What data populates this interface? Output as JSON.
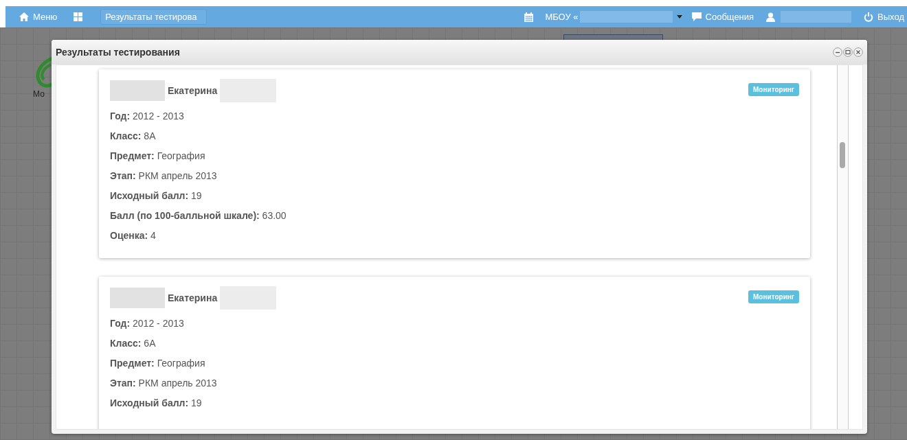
{
  "top_bar": {
    "menu_label": "Меню",
    "open_tab": "Результаты тестирова",
    "school_prefix": "МБОУ «",
    "messages_label": "Сообщения",
    "logout_label": "Выход"
  },
  "desktop": {
    "icon_label": "Мо"
  },
  "dialog": {
    "title": "Результаты тестирования",
    "cards": [
      {
        "name": "Екатерина",
        "badge": "Мониторинг",
        "fields": [
          {
            "label": "Год:",
            "value": "2012 - 2013"
          },
          {
            "label": "Класс:",
            "value": "8А"
          },
          {
            "label": "Предмет:",
            "value": "География"
          },
          {
            "label": "Этап:",
            "value": "РКМ апрель 2013"
          },
          {
            "label": "Исходный балл:",
            "value": "19"
          },
          {
            "label": "Балл (по 100-балльной шкале):",
            "value": "63.00"
          },
          {
            "label": "Оценка:",
            "value": "4"
          }
        ]
      },
      {
        "name": "Екатерина",
        "badge": "Мониторинг",
        "fields": [
          {
            "label": "Год:",
            "value": "2012 - 2013"
          },
          {
            "label": "Класс:",
            "value": "6А"
          },
          {
            "label": "Предмет:",
            "value": "География"
          },
          {
            "label": "Этап:",
            "value": "РКМ апрель 2013"
          },
          {
            "label": "Исходный балл:",
            "value": "19"
          }
        ]
      }
    ]
  }
}
